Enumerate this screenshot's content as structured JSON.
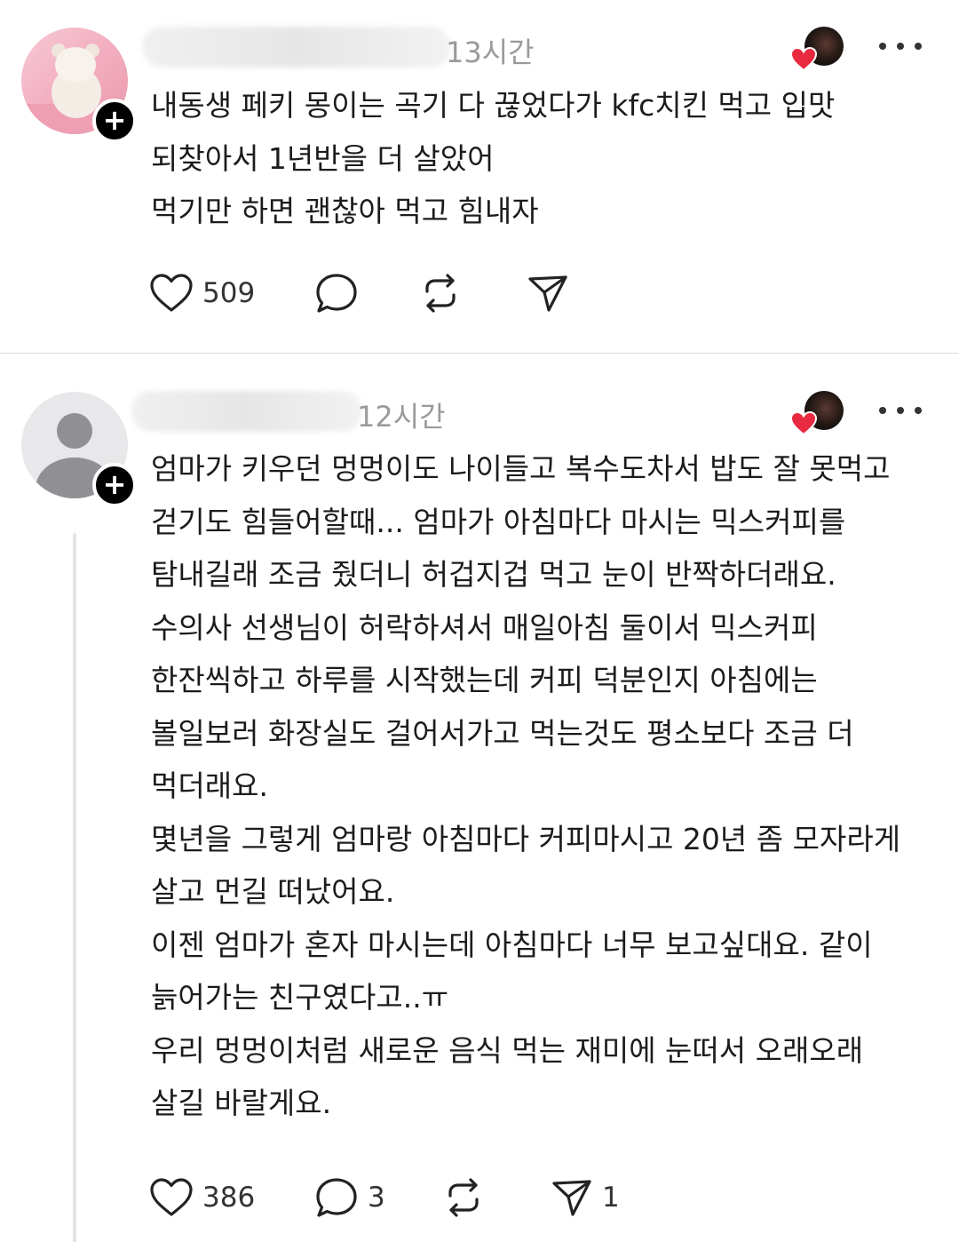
{
  "posts": [
    {
      "timestamp": "13시간",
      "avatar": "teddy-bear-photo",
      "text_lines": [
        "내동생 페키 몽이는 곡기 다 끊었다가 kfc치킨 먹고 입맛",
        "되찾아서 1년반을 더 살았어",
        "먹기만 하면 괜찮아 먹고 힘내자"
      ],
      "likes": "509",
      "replies": "",
      "reposts": "",
      "shares": ""
    },
    {
      "timestamp": "12시간",
      "avatar": "default-avatar",
      "text_lines": [
        "엄마가 키우던 멍멍이도 나이들고 복수도차서 밥도 잘 못먹고",
        "걷기도 힘들어할때... 엄마가 아침마다 마시는 믹스커피를",
        "탐내길래 조금 줬더니 허겁지겁 먹고 눈이 반짝하더래요.",
        "수의사 선생님이 허락하셔서 매일아침 둘이서 믹스커피",
        "한잔씩하고 하루를 시작했는데 커피 덕분인지 아침에는",
        "볼일보러 화장실도 걸어서가고 먹는것도 평소보다 조금 더",
        "먹더래요.",
        "몇년을 그렇게 엄마랑 아침마다 커피마시고 20년 좀 모자라게",
        "살고 먼길 떠났어요.",
        "이젠 엄마가 혼자 마시는데 아침마다 너무 보고싶대요. 같이",
        "늙어가는 친구였다고..ㅠ",
        "우리 멍멍이처럼 새로운 음식 먹는 재미에 눈떠서 오래오래",
        "살길 바랄게요."
      ],
      "likes": "386",
      "replies": "3",
      "reposts": "",
      "shares": "1"
    }
  ],
  "icons": {
    "follow": "+",
    "like": "heart-outline-icon",
    "reply": "speech-bubble-icon",
    "repost": "repost-arrows-icon",
    "share": "paper-plane-icon",
    "more": "more-dots-icon",
    "reaction": "heart-filled-icon"
  },
  "colors": {
    "reaction_heart": "#e8293f",
    "divider": "#dcdcdc",
    "timestamp": "#9a9a9a"
  }
}
